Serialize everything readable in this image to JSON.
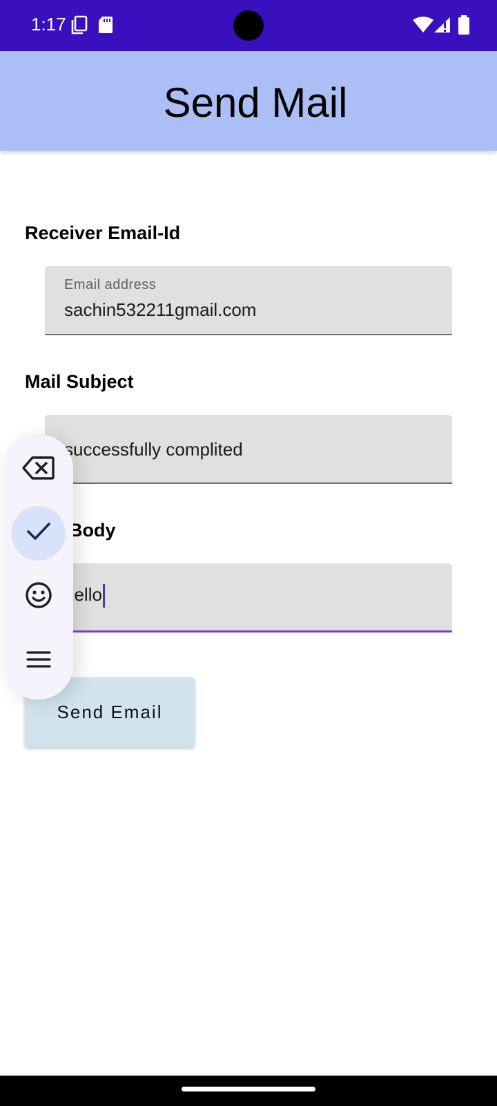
{
  "status_bar": {
    "time": "1:17",
    "left_icons": [
      "screenshot-icon",
      "sd-card-icon"
    ],
    "right_icons": [
      "wifi-icon",
      "signal-alert-icon",
      "battery-icon"
    ],
    "background_color": "#3a10be"
  },
  "app_bar": {
    "title": "Send Mail",
    "background_color": "#abbef5"
  },
  "form": {
    "receiver_label": "Receiver Email-Id",
    "email_field": {
      "floating_label": "Email address",
      "value": "sachin532211gmail.com"
    },
    "subject_label": "Mail Subject",
    "subject_field": {
      "value": "successfully complited"
    },
    "body_label": "Body",
    "body_field": {
      "value": "hello",
      "focused": true
    },
    "send_button_label": "Send Email"
  },
  "keyboard_toolbar": {
    "buttons": [
      {
        "icon": "backspace-icon",
        "active": false
      },
      {
        "icon": "check-icon",
        "active": true
      },
      {
        "icon": "emoji-icon",
        "active": false
      },
      {
        "icon": "menu-icon",
        "active": false
      }
    ]
  },
  "colors": {
    "focus_accent": "#7b3fd0",
    "field_background": "#e0e0e0",
    "button_background": "#d0e3ee",
    "toolbar_active": "#d8e3fb"
  }
}
